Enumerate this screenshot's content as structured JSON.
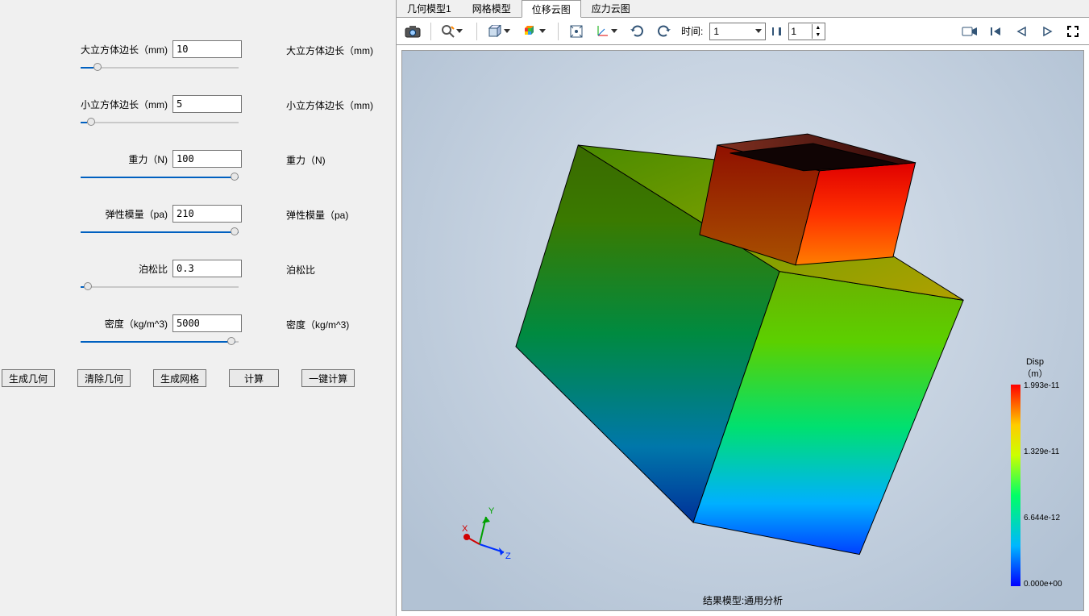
{
  "params": {
    "big_cube": {
      "label": "大立方体边长（mm)",
      "value": "10",
      "echo": "大立方体边长（mm)",
      "fill": 8
    },
    "small_cube": {
      "label": "小立方体边长（mm)",
      "value": "5",
      "echo": "小立方体边长（mm)",
      "fill": 4
    },
    "gravity": {
      "label": "重力（N)",
      "value": "100",
      "echo": "重力（N)",
      "fill": 100
    },
    "emod": {
      "label": "弹性模量（pa)",
      "value": "210",
      "echo": "弹性模量（pa)",
      "fill": 100
    },
    "poisson": {
      "label": "泊松比",
      "value": "0.3",
      "echo": "泊松比",
      "fill": 2
    },
    "density": {
      "label": "密度（kg/m^3)",
      "value": "5000",
      "echo": "密度（kg/m^3)",
      "fill": 98
    }
  },
  "buttons": {
    "gen_geom": "生成几何",
    "clear_geom": "清除几何",
    "gen_mesh": "生成网格",
    "calc": "计算",
    "one_key": "一键计算"
  },
  "tabs": {
    "geom": "几何模型1",
    "mesh": "网格模型",
    "disp": "位移云图",
    "stress": "应力云图",
    "active": "disp"
  },
  "toolbar": {
    "time_label": "时间:",
    "time_value": "1",
    "frame_value": "1"
  },
  "legend": {
    "title_1": "Disp",
    "title_2": "（m）",
    "ticks": [
      "1.993e-11",
      "1.329e-11",
      "6.644e-12",
      "0.000e+00"
    ]
  },
  "status": "结果模型:通用分析",
  "triad": {
    "x": "X",
    "y": "Y",
    "z": "Z"
  }
}
